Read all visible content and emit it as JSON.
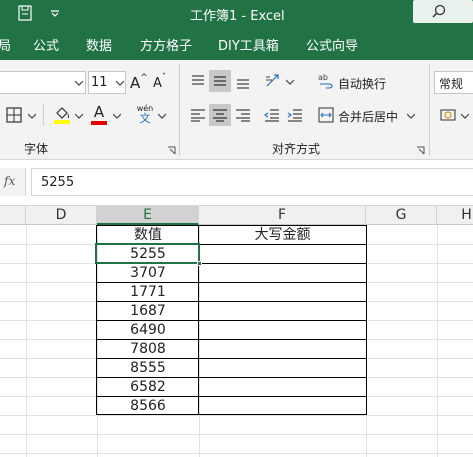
{
  "window": {
    "title": "工作簿1  -  Excel"
  },
  "search": {
    "icon": "search-icon"
  },
  "ribbon_tabs": [
    "局",
    "公式",
    "数据",
    "方方格子",
    "DIY工具箱",
    "公式向导"
  ],
  "font": {
    "size": "11",
    "group_label": "字体",
    "wen": "wén",
    "wen_char": "文",
    "grow": "A",
    "shrink": "A",
    "font_color": "A"
  },
  "align": {
    "wrap_label": "自动换行",
    "merge_label": "合并后居中",
    "group_label": "对齐方式"
  },
  "number": {
    "format": "常规"
  },
  "formula": {
    "fx": "fx",
    "value": "5255"
  },
  "columns": [
    "D",
    "E",
    "F",
    "G",
    "H"
  ],
  "table": {
    "headers": [
      "数值",
      "大写金额"
    ],
    "rows": [
      "5255",
      "3707",
      "1771",
      "1687",
      "6490",
      "7808",
      "8555",
      "6582",
      "8566"
    ]
  },
  "colors": {
    "brand": "#217346",
    "selection": "#217346"
  }
}
